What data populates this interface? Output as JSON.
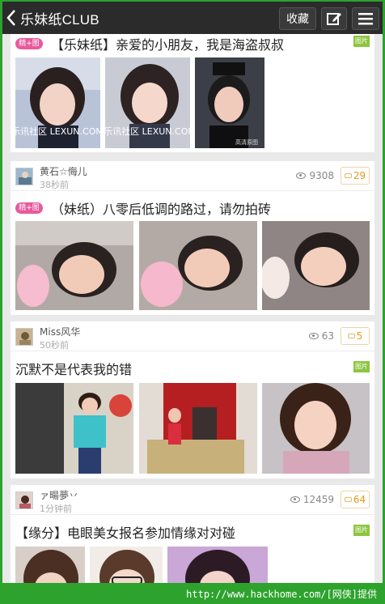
{
  "header": {
    "back_icon": "chevron-left-icon",
    "title": "乐妹纸CLUB",
    "favorite_label": "收藏",
    "edit_icon": "edit-icon",
    "menu_icon": "menu-icon"
  },
  "posts": [
    {
      "tag": "精+图",
      "title": "【乐妹纸】亲爱的小朋友，我是海盗叔叔",
      "img_badge": "图片",
      "watermarks": [
        "乐讯社区 LEXUN.COM",
        "乐讯社区 LEXUN.COM"
      ],
      "photo_caption": "高清原图"
    },
    {
      "user": "黄石☆侮儿",
      "time": "38秒前",
      "views": "9308",
      "replies": "29",
      "tag": "精+图",
      "title": "（妹纸）八零后低调的路过，请勿拍砖"
    },
    {
      "user": "Miss风华",
      "time": "50秒前",
      "views": "63",
      "replies": "5",
      "title": "沉默不是代表我的错",
      "img_badge": "图片"
    },
    {
      "user": "ァ暘夢丷",
      "time": "1分钟前",
      "views": "12459",
      "replies": "64",
      "title": "【缘分】电眼美女报名参加情缘对对碰",
      "img_badge": "图片"
    }
  ],
  "footer": {
    "text": "http://www.hackhome.com/[网侠]提供"
  },
  "colors": {
    "appbar": "#2b2b2b",
    "frame_green": "#2da32d",
    "tag_pink": "#e85a9c",
    "badge_green": "#8cc63f",
    "reply_orange": "#e89a1a"
  }
}
